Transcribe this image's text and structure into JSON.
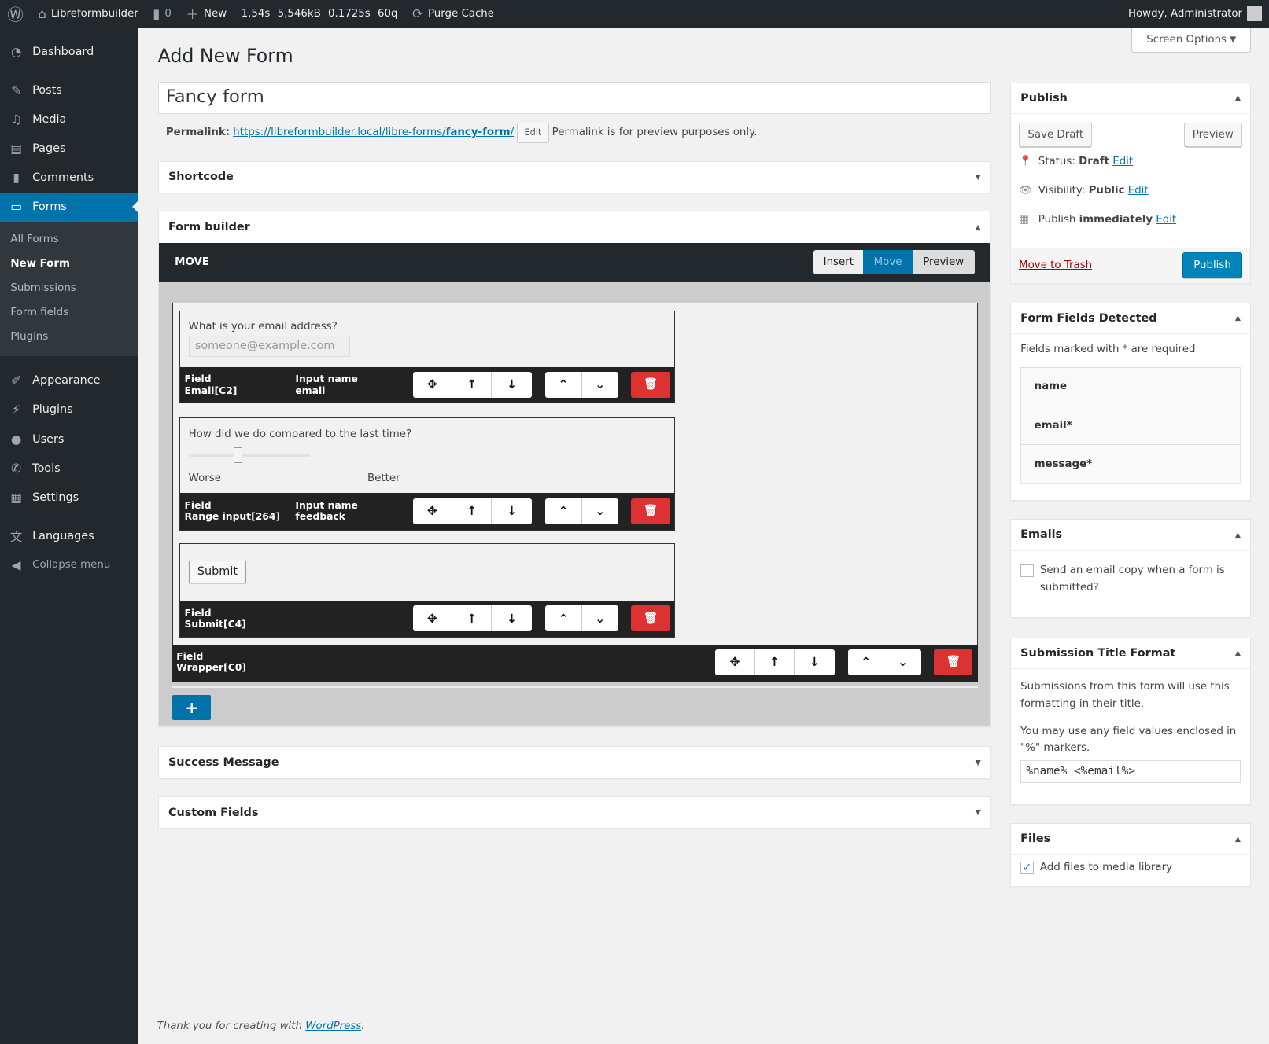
{
  "adminbar": {
    "site": "Libreformbuilder",
    "comments": "0",
    "new": "New",
    "stats": [
      "1.54s",
      "5,546kB",
      "0.1725s",
      "60q"
    ],
    "purge": "Purge Cache",
    "howdy": "Howdy, Administrator"
  },
  "sidebar": {
    "items": [
      {
        "label": "Dashboard",
        "icon": "dashboard-icon"
      },
      {
        "label": "Posts",
        "icon": "pin-icon"
      },
      {
        "label": "Media",
        "icon": "media-icon"
      },
      {
        "label": "Pages",
        "icon": "pages-icon"
      },
      {
        "label": "Comments",
        "icon": "comment-icon"
      },
      {
        "label": "Forms",
        "icon": "forms-icon"
      }
    ],
    "submenu": [
      "All Forms",
      "New Form",
      "Submissions",
      "Form fields",
      "Plugins"
    ],
    "items2": [
      {
        "label": "Appearance"
      },
      {
        "label": "Plugins"
      },
      {
        "label": "Users"
      },
      {
        "label": "Tools"
      },
      {
        "label": "Settings"
      },
      {
        "label": "Languages"
      },
      {
        "label": "Collapse menu"
      }
    ]
  },
  "screen_options": "Screen Options",
  "page_title": "Add New Form",
  "title_value": "Fancy form",
  "permalink": {
    "label": "Permalink:",
    "url_base": "https://libreformbuilder.local/libre-forms/",
    "slug": "fancy-form",
    "slash": "/",
    "edit": "Edit",
    "note": "Permalink is for preview purposes only."
  },
  "boxes": {
    "shortcode": "Shortcode",
    "form_builder": "Form builder",
    "success": "Success Message",
    "custom": "Custom Fields"
  },
  "builder": {
    "mode": "MOVE",
    "tabs": [
      "Insert",
      "Move",
      "Preview"
    ],
    "active_tab": "Move",
    "fields": [
      {
        "label": "What is your email address?",
        "placeholder": "someone@example.com",
        "field_label": "Field",
        "field": "Email[C2]",
        "input_label": "Input name",
        "input": "email"
      },
      {
        "label": "How did we do compared to the last time?",
        "min_label": "Worse",
        "max_label": "Better",
        "range_value": 0.4,
        "field_label": "Field",
        "field": "Range input[264]",
        "input_label": "Input name",
        "input": "feedback"
      },
      {
        "button": "Submit",
        "field_label": "Field",
        "field": "Submit[C4]"
      }
    ],
    "wrapper": {
      "field_label": "Field",
      "field": "Wrapper[C0]"
    },
    "add": "+"
  },
  "publish": {
    "title": "Publish",
    "save_draft": "Save Draft",
    "preview": "Preview",
    "status_label": "Status:",
    "status": "Draft",
    "visibility_label": "Visibility:",
    "visibility": "Public",
    "publish_label": "Publish",
    "publish_when": "immediately",
    "edit": "Edit",
    "trash": "Move to Trash",
    "publish_btn": "Publish"
  },
  "detected": {
    "title": "Form Fields Detected",
    "note": "Fields marked with * are required",
    "fields": [
      "name",
      "email*",
      "message*"
    ]
  },
  "emails": {
    "title": "Emails",
    "checkbox": "Send an email copy when a form is submitted?",
    "checked": false
  },
  "subtitle": {
    "title": "Submission Title Format",
    "p1": "Submissions from this form will use this formatting in their title.",
    "p2": "You may use any field values enclosed in \"%\" markers.",
    "value": "%name% <%email%>"
  },
  "files": {
    "title": "Files",
    "checkbox": "Add files to media library",
    "checked": true
  },
  "footer": {
    "text": "Thank you for creating with ",
    "link": "WordPress",
    "end": "."
  },
  "colors": {
    "accent": "#0073aa",
    "danger": "#dc3232",
    "dark": "#23282d"
  }
}
